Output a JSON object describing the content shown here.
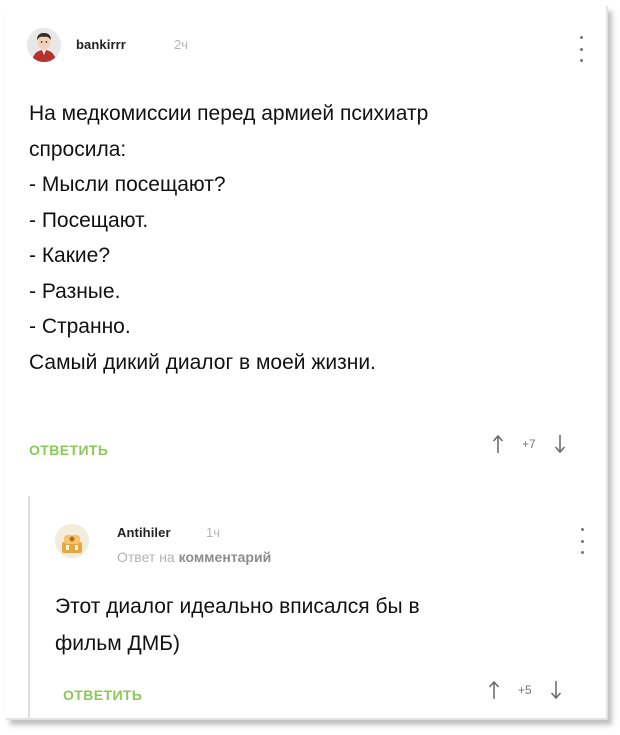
{
  "comments": [
    {
      "author": "bankirrr",
      "time": "2ч",
      "text": "На медкомиссии перед армией психиатр\nспросила:\n- Мысли посещают?\n- Посещают.\n- Какие?\n- Разные.\n- Странно.\nСамый дикий диалог в моей жизни.",
      "reply_label": "ОТВЕТИТЬ",
      "score": "+7"
    },
    {
      "author": "Antihiler",
      "time": "1ч",
      "reply_prefix": "Ответ на",
      "reply_target": "комментарий",
      "text": "Этот диалог идеально вписался бы в\nфильм ДМБ)",
      "reply_label": "ОТВЕТИТЬ",
      "score": "+5"
    }
  ],
  "colors": {
    "accent": "#8ac858",
    "muted": "#b5b5b5",
    "text": "#111111"
  },
  "icons": [
    "avatar",
    "more-vertical-icon",
    "upvote-arrow-icon",
    "downvote-arrow-icon"
  ]
}
